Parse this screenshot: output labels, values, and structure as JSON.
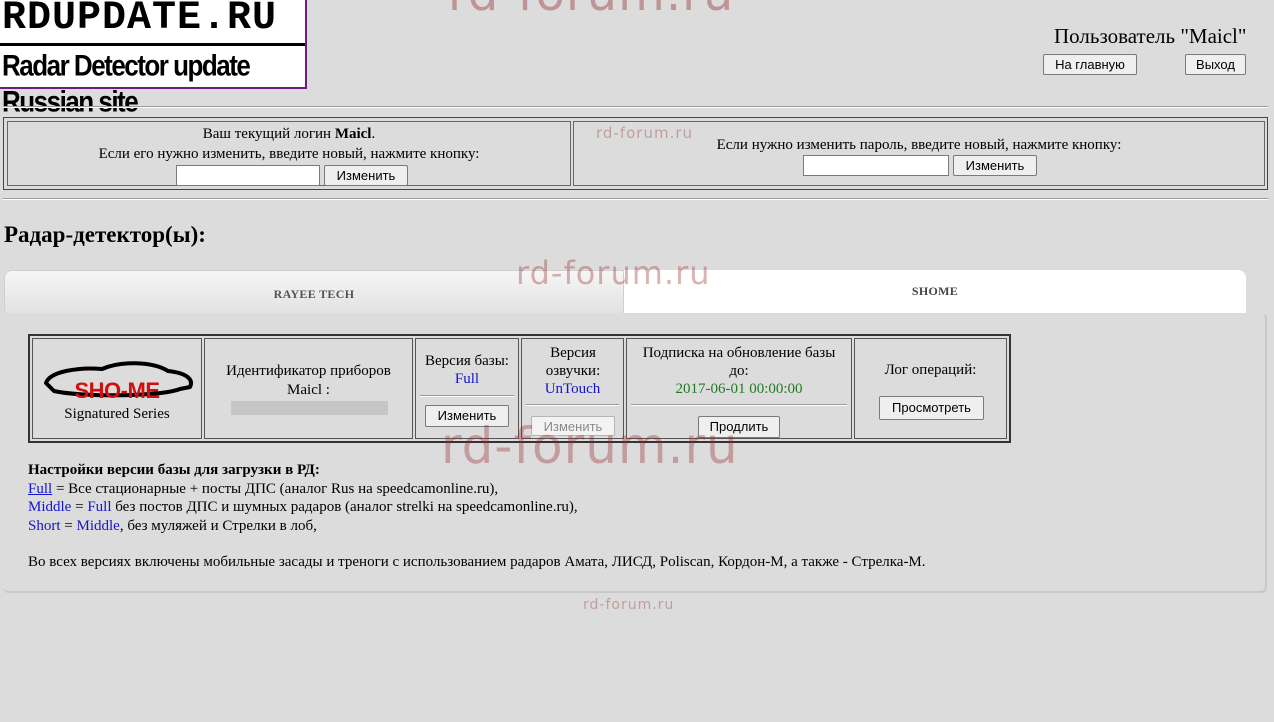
{
  "logo": {
    "title": "RDUPDATE.RU",
    "subtitle": "Radar Detector update Russian site"
  },
  "watermarks": {
    "top": "rd-forum.ru",
    "login_box": "rd-forum.ru",
    "tabs": "rd-forum.ru",
    "table": "rd-forum.ru",
    "bottom": "rd-forum.ru"
  },
  "header": {
    "user_label": "Пользователь \"Maicl\"",
    "home_button": "На главную",
    "logout_button": "Выход"
  },
  "login_section": {
    "line1_prefix": "Ваш текущий логин ",
    "login_name": "Maicl",
    "line1_suffix": ".",
    "line2": "Если его нужно изменить, введите новый, нажмите кнопку:",
    "login_input_value": "",
    "change_login_button": "Изменить",
    "password_text": "Если нужно изменить пароль, введите новый, нажмите кнопку:",
    "password_input_value": "",
    "change_password_button": "Изменить"
  },
  "section_title": "Радар-детектор(ы):",
  "tabs": [
    {
      "label": "RAYEE TECH",
      "active": false
    },
    {
      "label": "SHOME",
      "active": true
    }
  ],
  "device": {
    "brand_logo": "SHO-ME",
    "brand_series": "Signatured Series",
    "id_label": "Идентификатор приборов",
    "id_user": "Maicl :",
    "db_version_label": "Версия базы:",
    "db_version_value": "Full",
    "db_change_button": "Изменить",
    "voice_label": "Версия озвучки:",
    "voice_value": "UnTouch",
    "voice_change_button": "Изменить",
    "subscription_label": "Подписка на обновление базы до:",
    "subscription_value": "2017-06-01 00:00:00",
    "extend_button": "Продлить",
    "log_label": "Лог операций:",
    "log_button": "Просмотреть"
  },
  "settings": {
    "heading": "Настройки версии базы для загрузки в РД:",
    "full_key": "Full",
    "full_desc": " = Все стационарные + посты ДПС (аналог Rus на speedcamonline.ru),",
    "middle_key": "Middle",
    "middle_eq": " = ",
    "middle_ref": "Full",
    "middle_desc": " без постов ДПС и шумных радаров (аналог strelki на speedcamonline.ru),",
    "short_key": "Short",
    "short_eq": " = ",
    "short_ref": "Middle",
    "short_desc": ", без муляжей и Стрелки в лоб,",
    "note": "Во всех версиях включены мобильные засады и треноги с использованием радаров Амата, ЛИСД, Poliscan, Кордон-М, а также - Стрелка-М."
  },
  "colors": {
    "background": "#dcdcdc",
    "link_blue": "#1515cc",
    "date_green": "#237a23",
    "logo_red": "#d20f0f",
    "logo_border": "#6a1f7a"
  }
}
